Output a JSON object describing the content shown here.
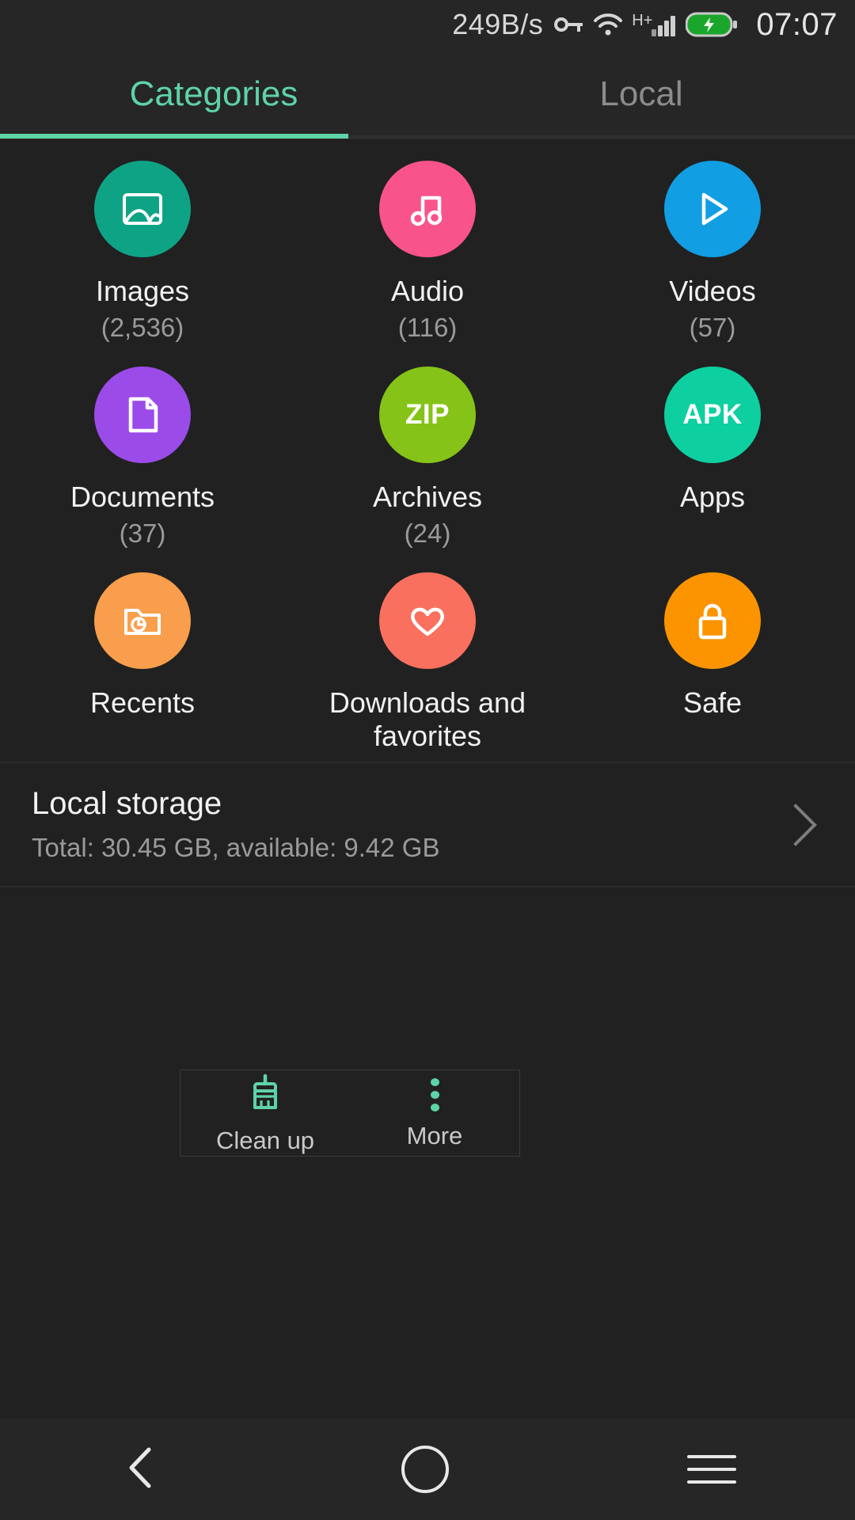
{
  "status_bar": {
    "network_speed": "249B/s",
    "vpn_icon": "key-icon",
    "wifi_icon": "wifi-icon",
    "network_type": "H+",
    "signal_icon": "signal-bars-icon",
    "battery_icon": "battery-charging-icon",
    "time": "07:07"
  },
  "tabs": [
    {
      "label": "Categories",
      "active": true
    },
    {
      "label": "Local",
      "active": false
    }
  ],
  "categories": [
    {
      "label": "Images",
      "count": "(2,536)",
      "icon": "image-icon",
      "color": "#0FA386"
    },
    {
      "label": "Audio",
      "count": "(116)",
      "icon": "music-note-icon",
      "color": "#F9538C"
    },
    {
      "label": "Videos",
      "count": "(57)",
      "icon": "play-icon",
      "color": "#119EE3"
    },
    {
      "label": "Documents",
      "count": "(37)",
      "icon": "document-icon",
      "color": "#9B4BE8"
    },
    {
      "label": "Archives",
      "count": "(24)",
      "icon": "zip-icon",
      "color": "#86C318",
      "badge": "ZIP"
    },
    {
      "label": "Apps",
      "count": "",
      "icon": "apk-icon",
      "color": "#0ECFA0",
      "badge": "APK"
    },
    {
      "label": "Recents",
      "count": "",
      "icon": "folder-clock-icon",
      "color": "#F89E4C"
    },
    {
      "label": "Downloads and favorites",
      "count": "",
      "icon": "heart-icon",
      "color": "#F9705E"
    },
    {
      "label": "Safe",
      "count": "",
      "icon": "lock-icon",
      "color": "#FB9400"
    }
  ],
  "storage": {
    "title": "Local storage",
    "subtitle": "Total: 30.45 GB, available: 9.42 GB",
    "chevron": "chevron-right-icon"
  },
  "bottom_actions": [
    {
      "label": "Clean up",
      "icon": "broom-icon"
    },
    {
      "label": "More",
      "icon": "overflow-dots-icon"
    }
  ],
  "nav_bar": [
    {
      "name": "back",
      "icon": "chevron-left-icon"
    },
    {
      "name": "home",
      "icon": "circle-icon"
    },
    {
      "name": "recents",
      "icon": "hamburger-icon"
    }
  ],
  "colors": {
    "accent": "#5ed3a8",
    "background": "#212121",
    "surface": "#262626"
  }
}
